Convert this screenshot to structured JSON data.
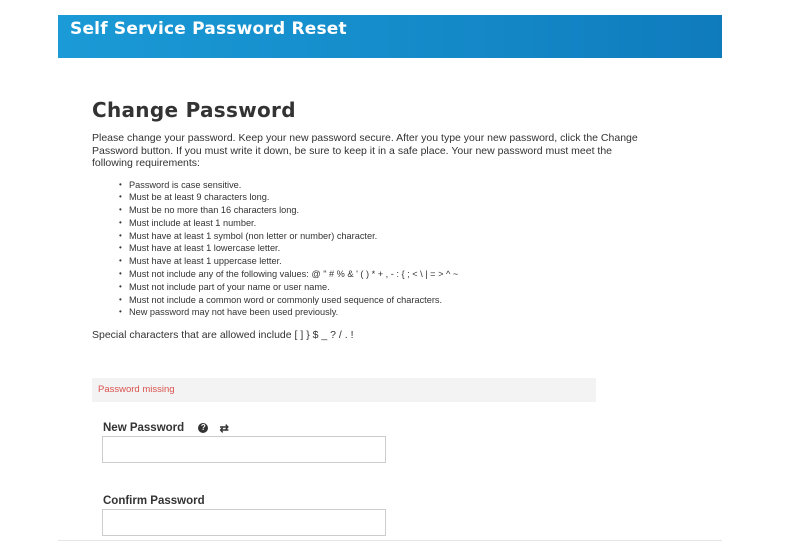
{
  "header": {
    "title": "Self Service Password Reset",
    "background_color": "#1386c6"
  },
  "main": {
    "title": "Change Password",
    "intro": "Please change your password. Keep your new password secure. After you type your new password, click the Change Password button. If you must write it down, be sure to keep it in a safe place. Your new password must meet the following requirements:",
    "requirements": [
      "Password is case sensitive.",
      "Must be at least 9 characters long.",
      "Must be no more than 16 characters long.",
      "Must include at least 1 number.",
      "Must have at least 1 symbol (non letter or number) character.",
      "Must have at least 1 lowercase letter.",
      "Must have at least 1 uppercase letter.",
      "Must not include any of the following values: @ \" # % & ' ( ) * + , - : { ; < \\ | = > ^ ~",
      "Must not include part of your name or user name.",
      "Must not include a common word or commonly used sequence of characters.",
      "New password may not have been used previously."
    ],
    "special_chars": "Special characters that are allowed include [ ] } $ _ ? / . !"
  },
  "alert": {
    "text": "Password missing",
    "color": "#d9534f"
  },
  "form": {
    "new_password_label": "New Password",
    "new_password_value": "",
    "confirm_password_label": "Confirm Password",
    "confirm_password_value": "",
    "icons": [
      "help-icon",
      "refresh-icon"
    ]
  }
}
